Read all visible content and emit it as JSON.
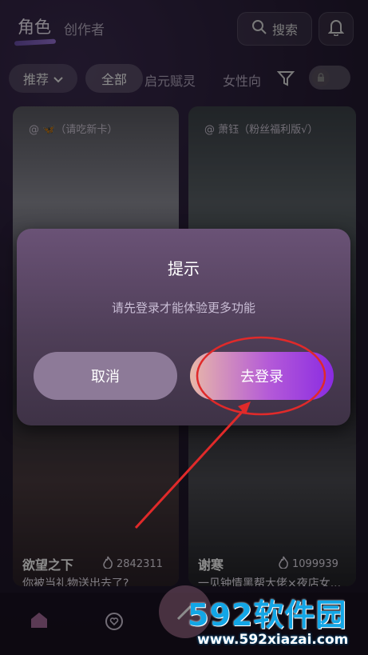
{
  "header": {
    "tab_active": "角色",
    "tab_inactive": "创作者",
    "search_label": "搜索"
  },
  "filters": {
    "recommend_label": "推荐",
    "all_label": "全部",
    "tab_qiyuan": "启元赋灵",
    "tab_female": "女性向"
  },
  "cards": [
    {
      "author": "@ 🦋（请吃新卡）"
    },
    {
      "author": "@ 萧钰（粉丝福利版√）"
    },
    {
      "name": "欲望之下",
      "count": "2842311",
      "desc": "你被当礼物送出去了?"
    },
    {
      "name": "谢寒",
      "count": "1099939",
      "desc": "一见钟情黑帮大佬×夜店女..."
    }
  ],
  "dialog": {
    "title": "提示",
    "message": "请先登录才能体验更多功能",
    "cancel_label": "取消",
    "login_label": "去登录"
  },
  "watermark": {
    "main": "592软件园",
    "sub": "www.592xiazai.com"
  },
  "colors": {
    "accent_gradient_start": "#e8b8a8",
    "accent_gradient_end": "#8a2be2",
    "annotation_red": "#e02a2a",
    "watermark_blue": "#12a6e6"
  }
}
